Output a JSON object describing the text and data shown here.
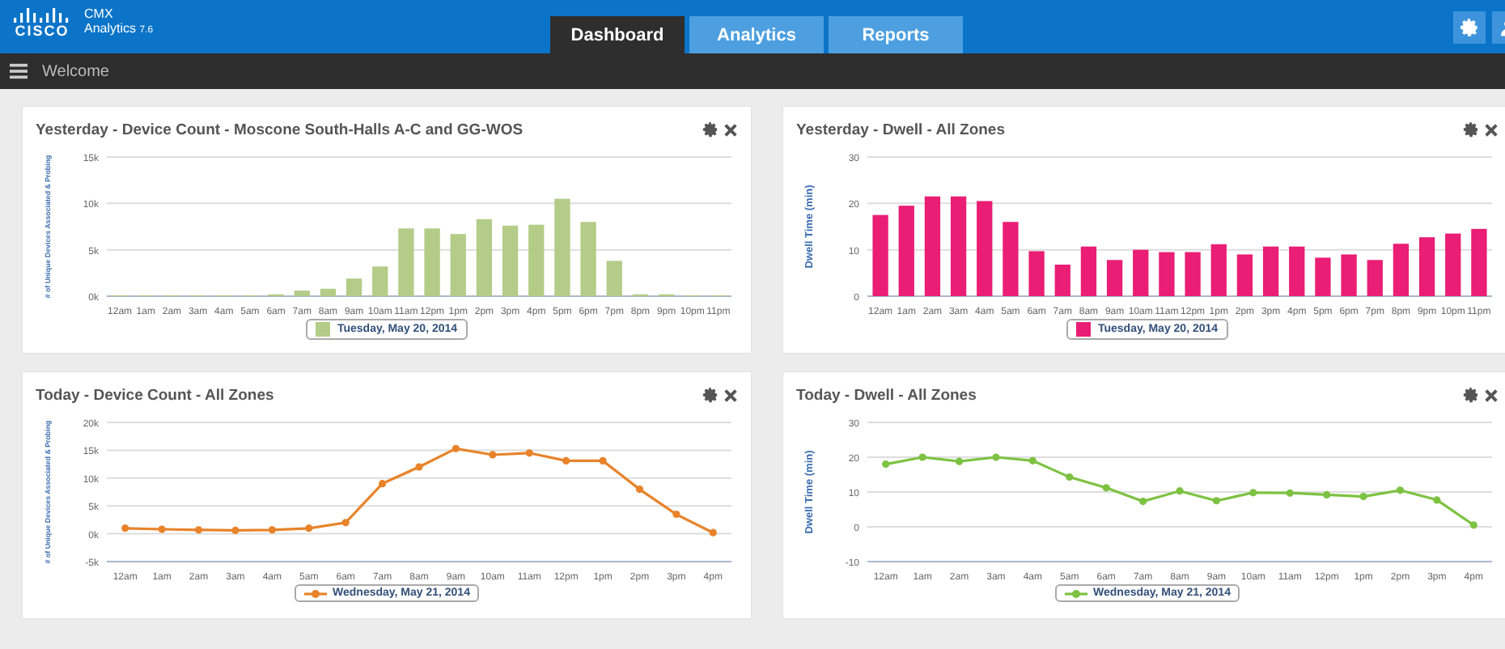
{
  "header": {
    "logo": "CISCO",
    "product": "CMX",
    "app": "Analytics",
    "version": "7.6"
  },
  "tabs": [
    {
      "label": "Dashboard",
      "selected": true
    },
    {
      "label": "Analytics",
      "selected": false
    },
    {
      "label": "Reports",
      "selected": false
    }
  ],
  "breadcrumb": "Welcome",
  "cards": [
    {
      "title": "Yesterday - Device Count - Moscone South-Halls A-C and GG-WOS",
      "chart_data": {
        "type": "bar",
        "grid": true,
        "ylabel": "# of Unique Devices Associated & Probing",
        "categories": [
          "12am",
          "1am",
          "2am",
          "3am",
          "4am",
          "5am",
          "6am",
          "7am",
          "8am",
          "9am",
          "10am",
          "11am",
          "12pm",
          "1pm",
          "2pm",
          "3pm",
          "4pm",
          "5pm",
          "6pm",
          "7pm",
          "8pm",
          "9pm",
          "10pm",
          "11pm"
        ],
        "ylim": [
          0,
          15000
        ],
        "yticks": [
          {
            "value": 0,
            "label": "0k"
          },
          {
            "value": 5000,
            "label": "5k"
          },
          {
            "value": 10000,
            "label": "10k"
          },
          {
            "value": 15000,
            "label": "15k"
          }
        ],
        "series": [
          {
            "name": "Tuesday, May 20, 2014",
            "color": "#b3cc88",
            "values": [
              100,
              100,
              100,
              100,
              100,
              100,
              200,
              600,
              800,
              1900,
              3200,
              7300,
              7300,
              6700,
              8300,
              7600,
              7700,
              10500,
              8000,
              3800,
              200,
              200,
              100,
              100
            ]
          }
        ]
      }
    },
    {
      "title": "Yesterday - Dwell - All Zones",
      "chart_data": {
        "type": "bar",
        "grid": true,
        "ylabel": "Dwell Time (min)",
        "categories": [
          "12am",
          "1am",
          "2am",
          "3am",
          "4am",
          "5am",
          "6am",
          "7am",
          "8am",
          "9am",
          "10am",
          "11am",
          "12pm",
          "1pm",
          "2pm",
          "3pm",
          "4pm",
          "5pm",
          "6pm",
          "7pm",
          "8pm",
          "9pm",
          "10pm",
          "11pm"
        ],
        "ylim": [
          0,
          30
        ],
        "yticks": [
          0,
          10,
          20,
          30
        ],
        "series": [
          {
            "name": "Tuesday, May 20, 2014",
            "color": "#e91e74",
            "values": [
              17.5,
              19.5,
              21.5,
              21.5,
              20.5,
              16,
              9.7,
              6.8,
              10.7,
              7.8,
              10,
              9.5,
              9.5,
              11.2,
              9,
              10.7,
              10.7,
              8.3,
              9,
              7.8,
              11.3,
              12.7,
              13.5,
              14.5
            ]
          }
        ]
      }
    },
    {
      "title": "Today - Device Count - All Zones",
      "chart_data": {
        "type": "line",
        "grid": true,
        "ylabel": "# of Unique Devices Associated & Probing",
        "categories": [
          "12am",
          "1am",
          "2am",
          "3am",
          "4am",
          "5am",
          "6am",
          "7am",
          "8am",
          "9am",
          "10am",
          "11am",
          "12pm",
          "1pm",
          "2pm",
          "3pm",
          "4pm"
        ],
        "ylim": [
          -5000,
          20000
        ],
        "yticks": [
          {
            "value": -5000,
            "label": "-5k"
          },
          {
            "value": 0,
            "label": "0k"
          },
          {
            "value": 5000,
            "label": "5k"
          },
          {
            "value": 10000,
            "label": "10k"
          },
          {
            "value": 15000,
            "label": "15k"
          },
          {
            "value": 20000,
            "label": "20k"
          }
        ],
        "series": [
          {
            "name": "Wednesday, May 21, 2014",
            "color": "#e8832a",
            "marker": "circle",
            "values": [
              1000,
              800,
              700,
              600,
              700,
              1000,
              2000,
              9000,
              12000,
              15300,
              14200,
              14500,
              13100,
              13100,
              8000,
              3500,
              200
            ]
          }
        ]
      }
    },
    {
      "title": "Today - Dwell - All Zones",
      "chart_data": {
        "type": "line",
        "grid": true,
        "ylabel": "Dwell Time (min)",
        "categories": [
          "12am",
          "1am",
          "2am",
          "3am",
          "4am",
          "5am",
          "6am",
          "7am",
          "8am",
          "9am",
          "10am",
          "11am",
          "12pm",
          "1pm",
          "2pm",
          "3pm",
          "4pm"
        ],
        "ylim": [
          -10,
          30
        ],
        "yticks": [
          -10,
          0,
          10,
          20,
          30
        ],
        "series": [
          {
            "name": "Wednesday, May 21, 2014",
            "color": "#7dc242",
            "marker": "circle",
            "values": [
              18,
              20,
              18.8,
              20,
              19,
              14.3,
              11.2,
              7.3,
              10.3,
              7.5,
              9.8,
              9.7,
              9.2,
              8.7,
              10.5,
              7.7,
              0.5
            ]
          }
        ]
      }
    }
  ]
}
